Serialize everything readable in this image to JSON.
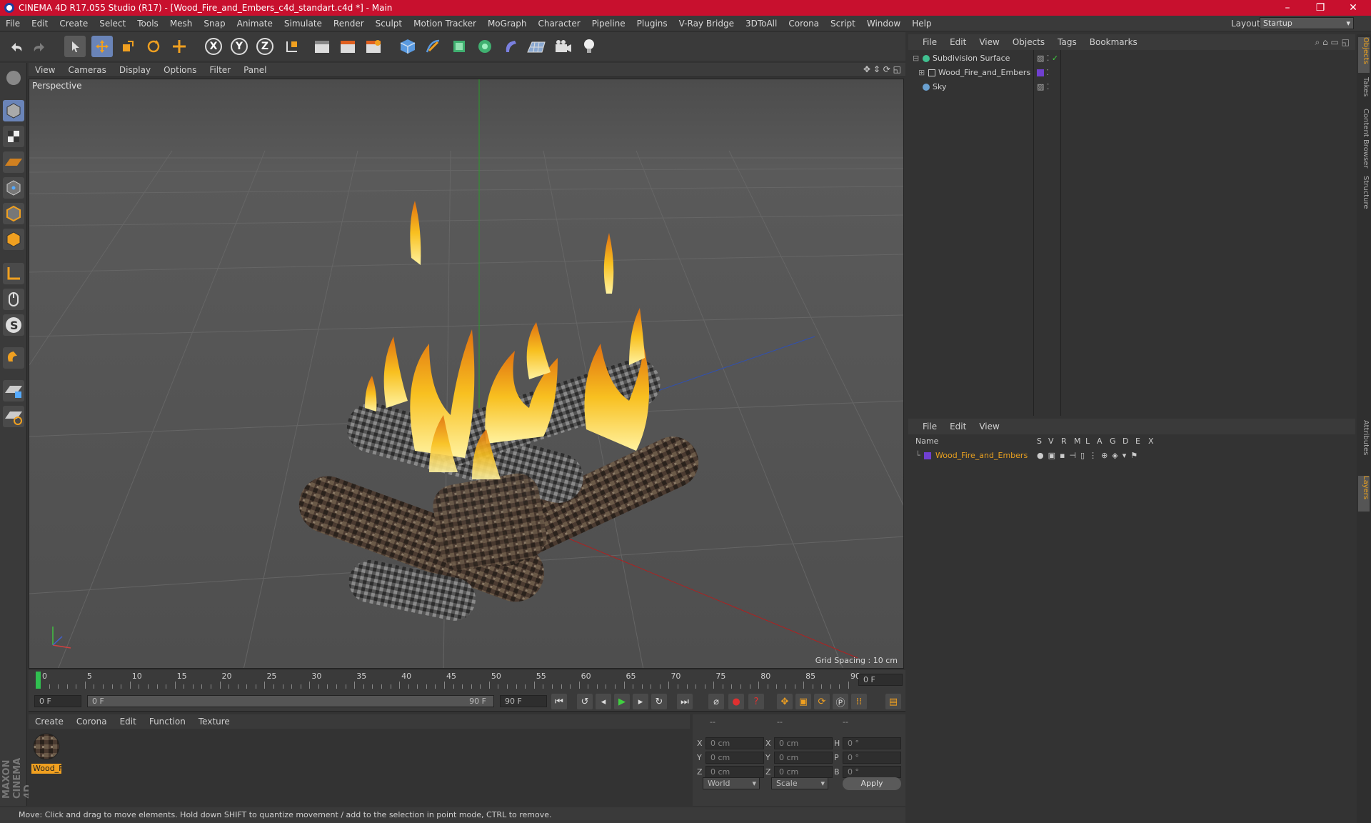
{
  "titlebar": {
    "title": "CINEMA 4D R17.055 Studio (R17) - [Wood_Fire_and_Embers_c4d_standart.c4d *] - Main",
    "minimize": "–",
    "maximize": "❐",
    "close": "✕"
  },
  "menubar": {
    "items": [
      "File",
      "Edit",
      "Create",
      "Select",
      "Tools",
      "Mesh",
      "Snap",
      "Animate",
      "Simulate",
      "Render",
      "Sculpt",
      "Motion Tracker",
      "MoGraph",
      "Character",
      "Pipeline",
      "Plugins",
      "V-Ray Bridge",
      "3DToAll",
      "Corona",
      "Script",
      "Window",
      "Help"
    ]
  },
  "layout": {
    "label": "Layout:",
    "value": "Startup"
  },
  "toolbar": {
    "axis_x": "X",
    "axis_y": "Y",
    "axis_z": "Z"
  },
  "viewport": {
    "menu": [
      "View",
      "Cameras",
      "Display",
      "Options",
      "Filter",
      "Panel"
    ],
    "label": "Perspective",
    "grid_spacing": "Grid Spacing : 10 cm"
  },
  "timeline": {
    "ticks": [
      "0",
      "5",
      "10",
      "15",
      "20",
      "25",
      "30",
      "35",
      "40",
      "45",
      "50",
      "55",
      "60",
      "65",
      "70",
      "75",
      "80",
      "85",
      "90"
    ],
    "current_frame": "0 F"
  },
  "transport": {
    "start": "0 F",
    "range_start": "0 F",
    "range_end": "90 F",
    "end": "90 F"
  },
  "materials": {
    "menu": [
      "Create",
      "Corona",
      "Edit",
      "Function",
      "Texture"
    ],
    "items": [
      {
        "label": "Wood_F"
      }
    ]
  },
  "coords": {
    "header": [
      "--",
      "--",
      "--"
    ],
    "rows": [
      {
        "a": "X",
        "av": "0 cm",
        "b": "X",
        "bv": "0 cm",
        "c": "H",
        "cv": "0 °"
      },
      {
        "a": "Y",
        "av": "0 cm",
        "b": "Y",
        "bv": "0 cm",
        "c": "P",
        "cv": "0 °"
      },
      {
        "a": "Z",
        "av": "0 cm",
        "b": "Z",
        "bv": "0 cm",
        "c": "B",
        "cv": "0 °"
      }
    ],
    "world": "World",
    "scale": "Scale",
    "apply": "Apply"
  },
  "statusbar": {
    "text": "Move: Click and drag to move elements. Hold down SHIFT to quantize movement / add to the selection in point mode, CTRL to remove."
  },
  "objects": {
    "menu": [
      "File",
      "Edit",
      "View",
      "Objects",
      "Tags",
      "Bookmarks"
    ],
    "rows": [
      {
        "name": "Subdivision Surface",
        "color": "#40c090"
      },
      {
        "name": "Wood_Fire_and_Embers",
        "color": "#d0d0d0"
      },
      {
        "name": "Sky",
        "color": "#6aa0d0"
      }
    ]
  },
  "layers": {
    "menu": [
      "File",
      "Edit",
      "View"
    ],
    "columns": [
      "Name",
      "S",
      "V",
      "R",
      "M",
      "L",
      "A",
      "G",
      "D",
      "E",
      "X"
    ],
    "rows": [
      {
        "name": "Wood_Fire_and_Embers",
        "color": "#e8a020"
      }
    ]
  },
  "rightstrip": {
    "tabs": [
      "Objects",
      "Takes",
      "Content Browser",
      "Structure",
      "Attributes",
      "Layers"
    ]
  },
  "brand": {
    "logo": "MAXON CINEMA 4D"
  }
}
